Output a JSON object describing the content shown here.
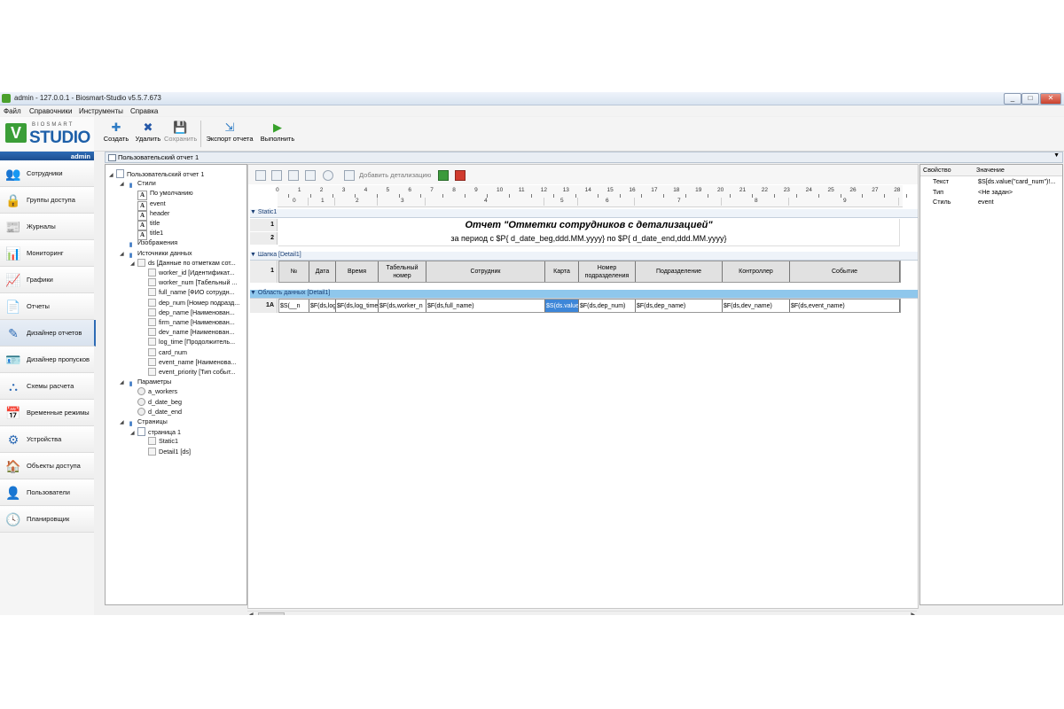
{
  "window": {
    "title": "admin - 127.0.0.1 - Biosmart-Studio v5.5.7.673",
    "buttons": {
      "minimize": "_",
      "maximize": "□",
      "close": "✕"
    }
  },
  "menu": [
    "Файл",
    "Справочники",
    "Инструменты",
    "Справка"
  ],
  "logo": {
    "small": "BIOSMART",
    "big": "STUDIO",
    "v": "V"
  },
  "toolbar": [
    {
      "label": "Создать",
      "icon": "add-icon",
      "color": "#2e7bc4",
      "glyph": "✚"
    },
    {
      "label": "Удалить",
      "icon": "delete-icon",
      "color": "#2558a8",
      "glyph": "✖"
    },
    {
      "label": "Сохранить",
      "icon": "save-icon",
      "color": "#888888",
      "glyph": "💾"
    },
    {
      "label": "Экспорт отчета",
      "icon": "export-icon",
      "color": "#2e7bc4",
      "glyph": "⇲"
    },
    {
      "label": "Выполнить",
      "icon": "run-icon",
      "color": "#37a12b",
      "glyph": "▶"
    }
  ],
  "sidebar": {
    "user": "admin",
    "items": [
      {
        "label": "Сотрудники",
        "icon": "employees-icon",
        "glyph": "👥"
      },
      {
        "label": "Группы доступа",
        "icon": "access-groups-icon",
        "glyph": "🔒"
      },
      {
        "label": "Журналы",
        "icon": "journals-icon",
        "glyph": "📰"
      },
      {
        "label": "Мониторинг",
        "icon": "monitoring-icon",
        "glyph": "📊"
      },
      {
        "label": "Графики",
        "icon": "charts-icon",
        "glyph": "📈"
      },
      {
        "label": "Отчеты",
        "icon": "reports-icon",
        "glyph": "📄"
      },
      {
        "label": "Дизайнер отчетов",
        "icon": "report-designer-icon",
        "glyph": "✎",
        "active": true
      },
      {
        "label": "Дизайнер пропусков",
        "icon": "pass-designer-icon",
        "glyph": "🪪"
      },
      {
        "label": "Схемы расчета",
        "icon": "calc-schemes-icon",
        "glyph": "⛬"
      },
      {
        "label": "Временные режимы",
        "icon": "time-modes-icon",
        "glyph": "📅"
      },
      {
        "label": "Устройства",
        "icon": "devices-icon",
        "glyph": "⚙"
      },
      {
        "label": "Объекты доступа",
        "icon": "access-objects-icon",
        "glyph": "🏠"
      },
      {
        "label": "Пользователи",
        "icon": "users-icon",
        "glyph": "👤"
      },
      {
        "label": "Планировщик",
        "icon": "scheduler-icon",
        "glyph": "🕓"
      }
    ]
  },
  "document_tab": "Пользовательский отчет 1",
  "tree": [
    {
      "level": 0,
      "exp": "◢",
      "type": "page",
      "label": "Пользовательский отчет 1"
    },
    {
      "level": 1,
      "exp": "◢",
      "type": "folder",
      "label": "Стили"
    },
    {
      "level": 2,
      "exp": "",
      "type": "style",
      "label": "По умолчанию"
    },
    {
      "level": 2,
      "exp": "",
      "type": "style",
      "label": "event"
    },
    {
      "level": 2,
      "exp": "",
      "type": "style",
      "label": "header"
    },
    {
      "level": 2,
      "exp": "",
      "type": "style",
      "label": "title"
    },
    {
      "level": 2,
      "exp": "",
      "type": "style",
      "label": "title1"
    },
    {
      "level": 1,
      "exp": "",
      "type": "folder",
      "label": "Изображения"
    },
    {
      "level": 1,
      "exp": "◢",
      "type": "folder",
      "label": "Источники данных"
    },
    {
      "level": 2,
      "exp": "◢",
      "type": "field",
      "label": "ds [Данные по отметкам сот..."
    },
    {
      "level": 3,
      "exp": "",
      "type": "field",
      "label": "worker_id [Идентификат..."
    },
    {
      "level": 3,
      "exp": "",
      "type": "field",
      "label": "worker_num [Табельный ..."
    },
    {
      "level": 3,
      "exp": "",
      "type": "field",
      "label": "full_name [ФИО сотрудн..."
    },
    {
      "level": 3,
      "exp": "",
      "type": "field",
      "label": "dep_num [Номер подразд..."
    },
    {
      "level": 3,
      "exp": "",
      "type": "field",
      "label": "dep_name [Наименован..."
    },
    {
      "level": 3,
      "exp": "",
      "type": "field",
      "label": "firm_name [Наименован..."
    },
    {
      "level": 3,
      "exp": "",
      "type": "field",
      "label": "dev_name [Наименован..."
    },
    {
      "level": 3,
      "exp": "",
      "type": "field",
      "label": "log_time [Продолжитель..."
    },
    {
      "level": 3,
      "exp": "",
      "type": "field",
      "label": "card_num"
    },
    {
      "level": 3,
      "exp": "",
      "type": "field",
      "label": "event_name [Наименова..."
    },
    {
      "level": 3,
      "exp": "",
      "type": "field",
      "label": "event_priority [Тип событ..."
    },
    {
      "level": 1,
      "exp": "◢",
      "type": "folder",
      "label": "Параметры"
    },
    {
      "level": 2,
      "exp": "",
      "type": "param",
      "label": "a_workers"
    },
    {
      "level": 2,
      "exp": "",
      "type": "param",
      "label": "d_date_beg"
    },
    {
      "level": 2,
      "exp": "",
      "type": "param",
      "label": "d_date_end"
    },
    {
      "level": 1,
      "exp": "◢",
      "type": "folder",
      "label": "Страницы"
    },
    {
      "level": 2,
      "exp": "◢",
      "type": "page",
      "label": "страница 1"
    },
    {
      "level": 3,
      "exp": "",
      "type": "field",
      "label": "Static1"
    },
    {
      "level": 3,
      "exp": "",
      "type": "field",
      "label": "Detail1 [ds]"
    }
  ],
  "designer_toolbar": {
    "add_detail": "Добавить детализацию"
  },
  "ruler": {
    "top": [
      "0",
      "1",
      "2",
      "3",
      "4",
      "5",
      "6",
      "7",
      "8",
      "9",
      "10",
      "11",
      "12",
      "13",
      "14",
      "15",
      "16",
      "17",
      "18",
      "19",
      "20",
      "21",
      "22",
      "23",
      "24",
      "25",
      "26",
      "27",
      "28"
    ],
    "cols": [
      "0",
      "1",
      "2",
      "3",
      "4",
      "5",
      "6",
      "7",
      "8",
      "9"
    ]
  },
  "bands": {
    "static": "Static1",
    "header": "Шапка [Detail1]",
    "data": "Область данных [Detail1]"
  },
  "report": {
    "title": "Отчет \"Отметки сотрудников с детализацией\"",
    "subtitle": "за период с $P{ d_date_beg,ddd.MM.yyyy} по $P{ d_date_end,ddd.MM.yyyy}",
    "row_labels": {
      "r1": "1",
      "r2": "2",
      "h1": "1",
      "d1": "1A"
    },
    "columns": [
      "№",
      "Дата",
      "Время",
      "Табельный номер",
      "Сотрудник",
      "Карта",
      "Номер подразделения",
      "Подразделение",
      "Контроллер",
      "Событие"
    ],
    "data_row": [
      "$S(__n",
      "$F(ds,log_time",
      "$F(ds,log_time",
      "$F(ds,worker_n",
      "$F(ds,full_name)",
      "$S(ds.value(\"ca",
      "$F(ds,dep_num)",
      "$F(ds,dep_name)",
      "$F(ds,dev_name)",
      "$F(ds,event_name)"
    ]
  },
  "properties": {
    "headers": {
      "name": "Свойство",
      "value": "Значение"
    },
    "rows": [
      {
        "name": "Текст",
        "value": "$S[ds.value(\"card_num\")!..."
      },
      {
        "name": "Тип",
        "value": "<Не задан>"
      },
      {
        "name": "Стиль",
        "value": "event"
      }
    ]
  }
}
